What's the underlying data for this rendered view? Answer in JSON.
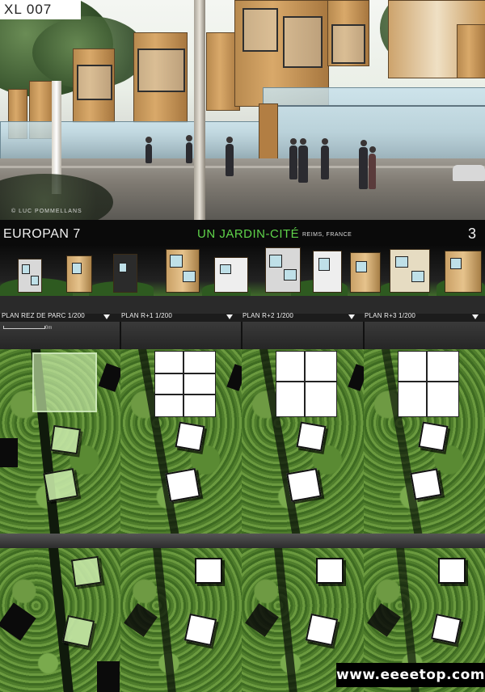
{
  "board": {
    "code": "XL 007",
    "credit": "© LUC POMMELLANS",
    "competition": "EUROPAN 7",
    "project_title": "UN JARDIN-CITÉ",
    "location": "REIMS, FRANCE",
    "sheet_number": "3"
  },
  "plans": [
    {
      "label": "PLAN REZ DE PARC   1/200"
    },
    {
      "label": "PLAN R+1  1/200"
    },
    {
      "label": "PLAN R+2  1/200"
    },
    {
      "label": "PLAN R+3  1/200"
    }
  ],
  "scale_bar": {
    "label": "0m"
  },
  "watermark": "www.eeeetop.com",
  "colors": {
    "title_green": "#5fd34a",
    "background": "#1c1c1c",
    "grass": "#5a8a33"
  }
}
